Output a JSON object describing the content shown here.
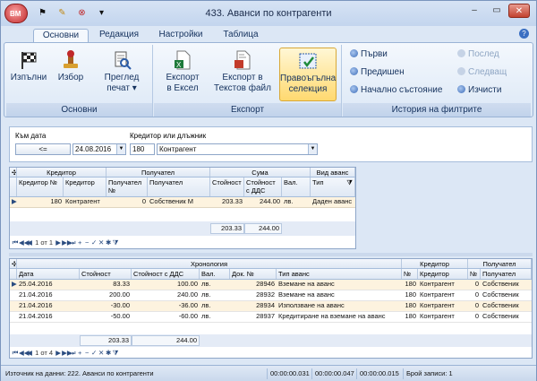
{
  "window": {
    "title": "433. Аванси по контрагенти",
    "app_logo": "BM"
  },
  "quick_access": [
    "flag-icon",
    "edit-icon",
    "close-circle-icon",
    "dropdown-icon"
  ],
  "tabs": [
    "Основни",
    "Редакция",
    "Настройки",
    "Таблица"
  ],
  "ribbon": {
    "groups": {
      "main": "Основни",
      "export": "Експорт",
      "history": "История на филтрите"
    },
    "execute": "Изпълни",
    "select": "Избор",
    "preview": "Преглед",
    "print": "печат",
    "export_excel_1": "Експорт",
    "export_excel_2": "в Ексел",
    "export_text_1": "Експорт в",
    "export_text_2": "Текстов файл",
    "rect_sel_1": "Правоъгълна",
    "rect_sel_2": "селекция",
    "first": "Първи",
    "last": "Послед",
    "prev": "Предишен",
    "next": "Следващ",
    "initial": "Начално състояние",
    "clear": "Изчисти"
  },
  "filter": {
    "date_label": "Към дата",
    "date_btn": "<=",
    "date_value": "24.08.2016",
    "party_label": "Кредитор или длъжник",
    "party_code": "180",
    "party_name": "Контрагент"
  },
  "grid1": {
    "groups": [
      "Кредитор",
      "Получател",
      "Сума",
      "Вид аванс"
    ],
    "cols": [
      "Кредитор №",
      "Кредитор",
      "Получател №",
      "Получател",
      "Стойност",
      "Стойност с ДДС",
      "Вал.",
      "Тип"
    ],
    "row": [
      "180",
      "Контрагент",
      "0",
      "Собственик М",
      "203.33",
      "244.00",
      "лв.",
      "Даден аванс"
    ],
    "totals": [
      "203.33",
      "244.00"
    ],
    "nav": "1 от 1"
  },
  "grid2": {
    "groups": [
      "Хронология",
      "Кредитор",
      "Получател"
    ],
    "cols": [
      "Дата",
      "Стойност",
      "Стойност с ДДС",
      "Вал.",
      "Док. №",
      "Тип аванс",
      "№",
      "Кредитор",
      "№",
      "Получател"
    ],
    "rows": [
      [
        "25.04.2016",
        "83.33",
        "100.00",
        "лв.",
        "28946",
        "Вземане на аванс",
        "180",
        "Контрагент",
        "0",
        "Собственик"
      ],
      [
        "21.04.2016",
        "200.00",
        "240.00",
        "лв.",
        "28932",
        "Вземане на аванс",
        "180",
        "Контрагент",
        "0",
        "Собственик"
      ],
      [
        "21.04.2016",
        "-30.00",
        "-36.00",
        "лв.",
        "28934",
        "Използване на аванс",
        "180",
        "Контрагент",
        "0",
        "Собственик"
      ],
      [
        "21.04.2016",
        "-50.00",
        "-60.00",
        "лв.",
        "28937",
        "Кредитиране на вземане на аванс",
        "180",
        "Контрагент",
        "0",
        "Собственик"
      ]
    ],
    "totals": [
      "203.33",
      "244.00"
    ],
    "nav": "1 от 4"
  },
  "status": {
    "source": "Източник на данни: 222. Аванси по контрагенти",
    "t1": "00:00:00.031",
    "t2": "00:00:00.047",
    "t3": "00:00:00.015",
    "count": "Брой записи: 1"
  },
  "colors": {
    "accent": "#15325e",
    "selected": "#ffd970",
    "odd_row": "#fdf3df"
  }
}
